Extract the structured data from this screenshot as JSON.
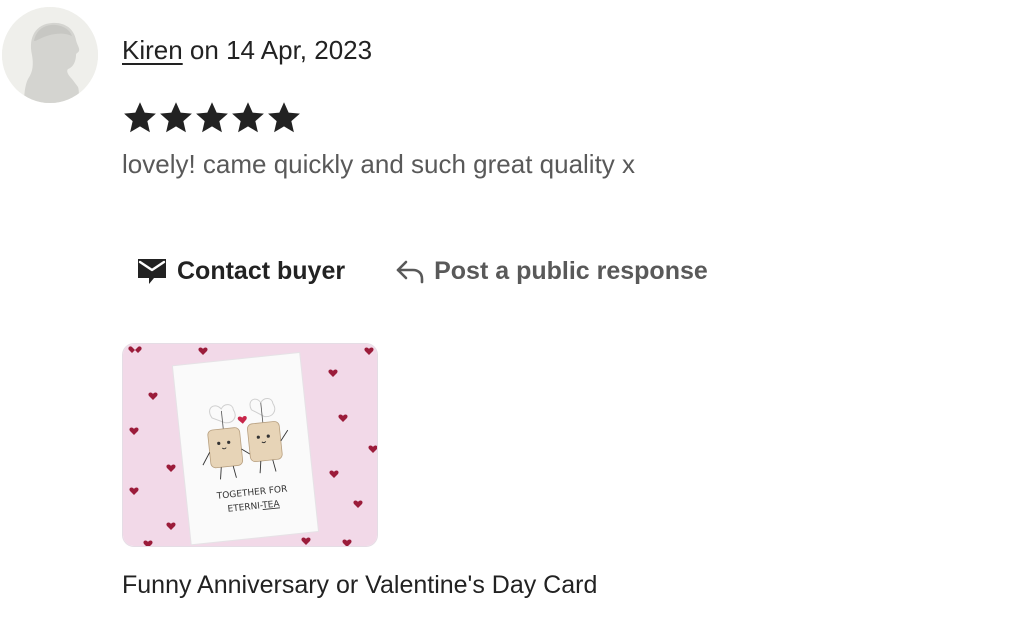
{
  "review": {
    "reviewer_name": "Kiren",
    "date_text": " on 14 Apr, 2023",
    "rating": 5,
    "rating_max": 5,
    "text": "lovely! came quickly and such great quality x"
  },
  "actions": {
    "contact_label": "Contact buyer",
    "respond_label": "Post a public response"
  },
  "product": {
    "title": "Funny Anniversary or Valentine's Day Card",
    "card_text_line1": "TOGETHER FOR",
    "card_text_line2_prefix": "ETERNI-",
    "card_text_line2_emph": "TEA"
  },
  "colors": {
    "text": "#222222",
    "muted_text": "#595959",
    "avatar_bg": "#efefeb",
    "thumb_bg": "#f2d9e8",
    "heart": "#9b1c3a"
  },
  "icons": {
    "avatar": "user-silhouette-icon",
    "star": "star-icon",
    "contact": "envelope-icon",
    "respond": "reply-arrow-icon"
  }
}
